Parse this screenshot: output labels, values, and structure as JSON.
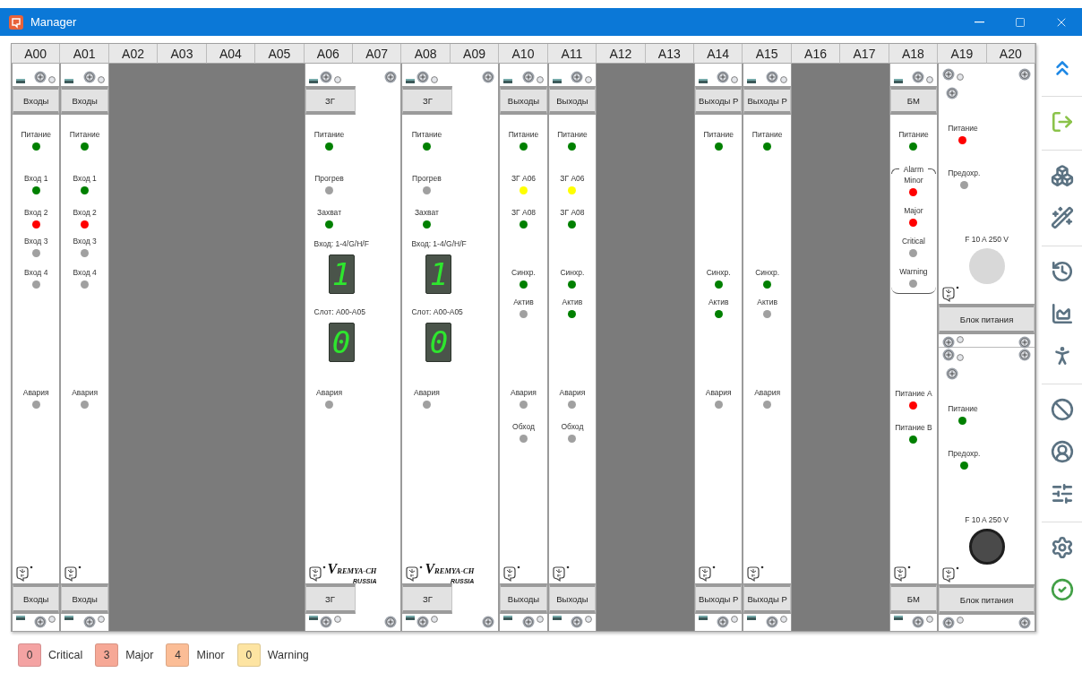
{
  "window": {
    "title": "Manager"
  },
  "rack": {
    "slots": [
      "A00",
      "A01",
      "A02",
      "A03",
      "A04",
      "A05",
      "A06",
      "A07",
      "A08",
      "A09",
      "A10",
      "A11",
      "A12",
      "A13",
      "A14",
      "A15",
      "A16",
      "A17",
      "A18",
      "A19",
      "A20"
    ],
    "modules": [
      {
        "kind": "inputs",
        "handle_top": "Входы",
        "indicators": [
          {
            "kind": "led",
            "label": "Питание",
            "color": "#008000"
          },
          {
            "kind": "led",
            "label": "Вход 1",
            "color": "#008000"
          },
          {
            "kind": "led",
            "label": "Вход 2",
            "color": "#ff0000"
          },
          {
            "kind": "led",
            "label": "Вход 3",
            "color": "#a0a0a0"
          },
          {
            "kind": "led",
            "label": "Вход 4",
            "color": "#a0a0a0"
          },
          {
            "kind": "led",
            "label": "Авария",
            "color": "#a0a0a0"
          }
        ],
        "handle_bottom": "Входы"
      },
      {
        "kind": "inputs",
        "handle_top": "Входы",
        "indicators": [
          {
            "kind": "led",
            "label": "Питание",
            "color": "#008000"
          },
          {
            "kind": "led",
            "label": "Вход 1",
            "color": "#008000"
          },
          {
            "kind": "led",
            "label": "Вход 2",
            "color": "#ff0000"
          },
          {
            "kind": "led",
            "label": "Вход 3",
            "color": "#a0a0a0"
          },
          {
            "kind": "led",
            "label": "Вход 4",
            "color": "#a0a0a0"
          },
          {
            "kind": "led",
            "label": "Авария",
            "color": "#a0a0a0"
          }
        ],
        "handle_bottom": "Входы"
      },
      {
        "kind": "empty"
      },
      {
        "kind": "empty"
      },
      {
        "kind": "empty"
      },
      {
        "kind": "empty"
      },
      {
        "kind": "zg",
        "handle_top": "ЗГ",
        "indicators": [
          {
            "kind": "led",
            "label": "Питание",
            "color": "#008000"
          },
          {
            "kind": "led",
            "label": "Прогрев",
            "color": "#a0a0a0"
          },
          {
            "kind": "led",
            "label": "Захват",
            "color": "#008000"
          },
          {
            "kind": "display",
            "label": "Вход: 1-4/G/H/F",
            "value": "1"
          },
          {
            "kind": "display",
            "label": "Слот: A00-A05",
            "value": "0"
          },
          {
            "kind": "led",
            "label": "Авария",
            "color": "#a0a0a0"
          }
        ],
        "brand": "VREMYA-CH",
        "brand_sub": "RUSSIA",
        "handle_bottom": "ЗГ"
      },
      {
        "kind": "zg",
        "handle_top": "ЗГ",
        "indicators": [
          {
            "kind": "led",
            "label": "Питание",
            "color": "#008000"
          },
          {
            "kind": "led",
            "label": "Прогрев",
            "color": "#a0a0a0"
          },
          {
            "kind": "led",
            "label": "Захват",
            "color": "#008000"
          },
          {
            "kind": "display",
            "label": "Вход: 1-4/G/H/F",
            "value": "1"
          },
          {
            "kind": "display",
            "label": "Слот: A00-A05",
            "value": "0"
          },
          {
            "kind": "led",
            "label": "Авария",
            "color": "#a0a0a0"
          }
        ],
        "brand": "VREMYA-CH",
        "brand_sub": "RUSSIA",
        "handle_bottom": "ЗГ"
      },
      {
        "kind": "outputs",
        "handle_top": "Выходы",
        "indicators": [
          {
            "kind": "led",
            "label": "Питание",
            "color": "#008000"
          },
          {
            "kind": "led",
            "label": "ЗГ A06",
            "color": "#ffff00"
          },
          {
            "kind": "led",
            "label": "ЗГ A08",
            "color": "#008000"
          },
          {
            "kind": "led",
            "label": "Синхр.",
            "color": "#008000"
          },
          {
            "kind": "led",
            "label": "Актив",
            "color": "#a0a0a0"
          },
          {
            "kind": "led",
            "label": "Авария",
            "color": "#a0a0a0"
          },
          {
            "kind": "led",
            "label": "Обход",
            "color": "#a0a0a0"
          }
        ],
        "handle_bottom": "Выходы"
      },
      {
        "kind": "outputs",
        "handle_top": "Выходы",
        "indicators": [
          {
            "kind": "led",
            "label": "Питание",
            "color": "#008000"
          },
          {
            "kind": "led",
            "label": "ЗГ A06",
            "color": "#ffff00"
          },
          {
            "kind": "led",
            "label": "ЗГ A08",
            "color": "#008000"
          },
          {
            "kind": "led",
            "label": "Синхр.",
            "color": "#008000"
          },
          {
            "kind": "led",
            "label": "Актив",
            "color": "#008000"
          },
          {
            "kind": "led",
            "label": "Авария",
            "color": "#a0a0a0"
          },
          {
            "kind": "led",
            "label": "Обход",
            "color": "#a0a0a0"
          }
        ],
        "handle_bottom": "Выходы"
      },
      {
        "kind": "empty"
      },
      {
        "kind": "empty"
      },
      {
        "kind": "outputs_r",
        "handle_top": "Выходы Р",
        "indicators": [
          {
            "kind": "led",
            "label": "Питание",
            "color": "#008000"
          },
          {
            "kind": "led",
            "label": "Синхр.",
            "color": "#008000"
          },
          {
            "kind": "led",
            "label": "Актив",
            "color": "#008000"
          },
          {
            "kind": "led",
            "label": "Авария",
            "color": "#a0a0a0"
          }
        ],
        "handle_bottom": "Выходы Р"
      },
      {
        "kind": "outputs_r",
        "handle_top": "Выходы Р",
        "indicators": [
          {
            "kind": "led",
            "label": "Питание",
            "color": "#008000"
          },
          {
            "kind": "led",
            "label": "Синхр.",
            "color": "#008000"
          },
          {
            "kind": "led",
            "label": "Актив",
            "color": "#a0a0a0"
          },
          {
            "kind": "led",
            "label": "Авария",
            "color": "#a0a0a0"
          }
        ],
        "handle_bottom": "Выходы Р"
      },
      {
        "kind": "empty"
      },
      {
        "kind": "empty"
      },
      {
        "kind": "bm",
        "handle_top": "БМ",
        "indicators": [
          {
            "kind": "led",
            "label": "Питание",
            "color": "#008000"
          },
          {
            "kind": "group",
            "title": "Alarm",
            "indicators": [
              {
                "kind": "led",
                "label": "Minor",
                "color": "#ff0000"
              },
              {
                "kind": "led",
                "label": "Major",
                "color": "#ff0000"
              },
              {
                "kind": "led",
                "label": "Critical",
                "color": "#a0a0a0"
              },
              {
                "kind": "led",
                "label": "Warning",
                "color": "#a0a0a0"
              }
            ]
          },
          {
            "kind": "led",
            "label": "Питание A",
            "color": "#ff0000"
          },
          {
            "kind": "led",
            "label": "Питание B",
            "color": "#008000"
          }
        ],
        "handle_bottom": "БМ"
      },
      {
        "kind": "power",
        "units": [
          {
            "indicators": [
              {
                "kind": "led",
                "label": "Питание",
                "color": "#ff0000"
              },
              {
                "kind": "led",
                "label": "Предохр.",
                "color": "#a0a0a0"
              }
            ],
            "fuse_rating": "F 10 A 250 V",
            "fuse_inserted": false,
            "handle": "Блок питания"
          },
          {
            "indicators": [
              {
                "kind": "led",
                "label": "Питание",
                "color": "#008000"
              },
              {
                "kind": "led",
                "label": "Предохр.",
                "color": "#008000"
              }
            ],
            "fuse_rating": "F 10 A 250 V",
            "fuse_inserted": true,
            "handle": "Блок питания"
          }
        ]
      }
    ]
  },
  "legend": [
    {
      "count": "0",
      "label": "Critical",
      "color": "#f4a3a3"
    },
    {
      "count": "3",
      "label": "Major",
      "color": "#f6a896"
    },
    {
      "count": "4",
      "label": "Minor",
      "color": "#fbbd96"
    },
    {
      "count": "0",
      "label": "Warning",
      "color": "#fde4a2"
    }
  ]
}
